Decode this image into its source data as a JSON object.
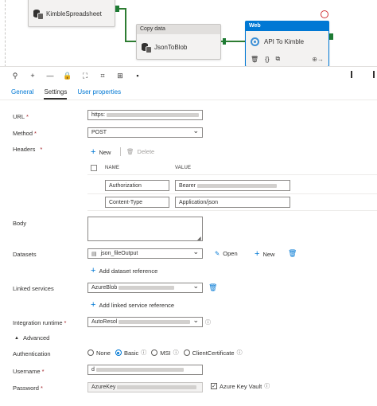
{
  "canvas": {
    "activities": {
      "spreadsheet": {
        "label": "KimbleSpreadsheet"
      },
      "copy": {
        "type_label": "Copy data",
        "label": "JsonToBlob"
      },
      "web": {
        "type_label": "Web",
        "label": "API To Kimble",
        "actions": {
          "delete": "🗑",
          "params": "{}",
          "copy": "⧉",
          "arrow": "⊕→"
        }
      }
    }
  },
  "toolbar": {
    "icons": [
      "search-icon",
      "zoom-in-icon",
      "zoom-out-icon",
      "lock-icon",
      "fit-icon",
      "zoom-fit-icon",
      "layout-icon",
      "group-icon"
    ],
    "glyphs": [
      "⚲",
      "+",
      "—",
      "🔒",
      "⛶",
      "⌗",
      "⊞",
      "▪"
    ]
  },
  "tabs": [
    {
      "label": "General"
    },
    {
      "label": "Settings"
    },
    {
      "label": "User properties"
    }
  ],
  "form": {
    "url": {
      "label": "URL",
      "required": "*",
      "value": "https:"
    },
    "method": {
      "label": "Method",
      "required": "*",
      "value": "POST"
    },
    "headers": {
      "label": "Headers",
      "required": "*",
      "new_label": "New",
      "delete_label": "Delete",
      "col_name": "NAME",
      "col_value": "VALUE",
      "rows": [
        {
          "name": "Authorization",
          "value": "Bearer"
        },
        {
          "name": "Content-Type",
          "value": "Application/json"
        }
      ]
    },
    "body": {
      "label": "Body"
    },
    "datasets": {
      "label": "Datasets",
      "value": "json_fileOutput",
      "open_label": "Open",
      "new_label": "New",
      "add_label": "Add dataset reference"
    },
    "linked_services": {
      "label": "Linked services",
      "value": "AzureBlob",
      "add_label": "Add linked service reference"
    },
    "integration_runtime": {
      "label": "Integration runtime",
      "required": "*",
      "value": "AutoResol"
    },
    "advanced": {
      "label": "Advanced"
    },
    "authentication": {
      "label": "Authentication",
      "options": [
        "None",
        "Basic",
        "MSI",
        "ClientCertificate"
      ],
      "selected": "Basic"
    },
    "username": {
      "label": "Username",
      "required": "*",
      "value": "d"
    },
    "password": {
      "label": "Password",
      "required": "*",
      "value": "AzureKey",
      "key_vault_label": "Azure Key Vault"
    }
  },
  "colors": {
    "accent": "#0078d4",
    "connector": "#2e7d32",
    "required": "#a4262c"
  }
}
